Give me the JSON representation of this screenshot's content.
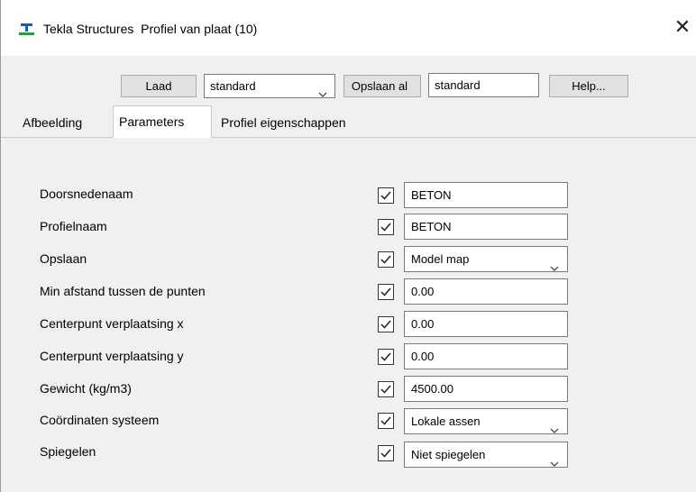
{
  "window": {
    "app_name": "Tekla Structures",
    "dialog_title": "Profiel van plaat  (10)",
    "close_icon": "close-icon",
    "app_icon": "tekla-icon"
  },
  "toolbar": {
    "load_label": "Laad",
    "load_select_value": "standard",
    "save_as_label": "Opslaan al",
    "save_as_value": "standard",
    "help_label": "Help..."
  },
  "tabs": [
    {
      "label": "Afbeelding",
      "active": false
    },
    {
      "label": "Parameters",
      "active": true
    },
    {
      "label": "Profiel eigenschappen",
      "active": false
    }
  ],
  "parameters": [
    {
      "label": "Doorsnedenaam",
      "checked": true,
      "type": "text",
      "value": "BETON"
    },
    {
      "label": "Profielnaam",
      "checked": true,
      "type": "text",
      "value": "BETON"
    },
    {
      "label": "Opslaan",
      "checked": true,
      "type": "select",
      "value": "Model map"
    },
    {
      "label": "Min afstand tussen de punten",
      "checked": true,
      "type": "text",
      "value": "0.00"
    },
    {
      "label": "Centerpunt verplaatsing x",
      "checked": true,
      "type": "text",
      "value": "0.00"
    },
    {
      "label": "Centerpunt verplaatsing y",
      "checked": true,
      "type": "text",
      "value": "0.00"
    },
    {
      "label": "Gewicht (kg/m3)",
      "checked": true,
      "type": "text",
      "value": "4500.00"
    },
    {
      "label": "Coördinaten systeem",
      "checked": true,
      "type": "select",
      "value": "Lokale assen"
    },
    {
      "label": "Spiegelen",
      "checked": true,
      "type": "select",
      "value": "Niet spiegelen"
    }
  ],
  "colors": {
    "dialog_background": "#f0f0f0",
    "title_background": "#ffffff",
    "icon_blue": "#1a5ea8",
    "icon_green": "#2e9a3c"
  }
}
